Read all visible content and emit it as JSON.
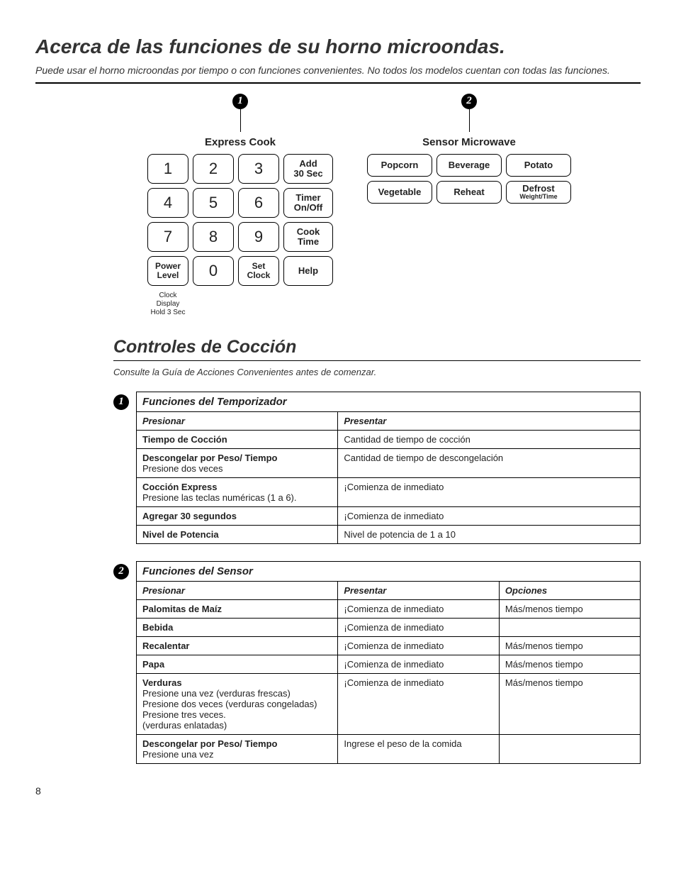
{
  "title": "Acerca de las funciones de su horno microondas.",
  "subtitle": "Puede usar el horno microondas por tiempo o con funciones convenientes. No todos los modelos cuentan con todas las funciones.",
  "panel1": {
    "num": "1",
    "title": "Express Cook",
    "keys": {
      "k1": "1",
      "k2": "2",
      "k3": "3",
      "k4": "4",
      "k5": "5",
      "k6": "6",
      "k7": "7",
      "k8": "8",
      "k9": "9",
      "k0": "0",
      "add30_l1": "Add",
      "add30_l2": "30 Sec",
      "timer_l1": "Timer",
      "timer_l2": "On/Off",
      "cook_l1": "Cook",
      "cook_l2": "Time",
      "power_l1": "Power",
      "power_l2": "Level",
      "setclock_l1": "Set",
      "setclock_l2": "Clock",
      "help": "Help",
      "foot_l1": "Clock Display",
      "foot_l2": "Hold 3 Sec"
    }
  },
  "panel2": {
    "num": "2",
    "title": "Sensor Microwave",
    "keys": {
      "popcorn": "Popcorn",
      "beverage": "Beverage",
      "potato": "Potato",
      "vegetable": "Vegetable",
      "reheat": "Reheat",
      "defrost_l1": "Defrost",
      "defrost_l2": "Weight/Time"
    }
  },
  "section2": {
    "title": "Controles de Cocción",
    "note": "Consulte la Guía de Acciones Convenientes antes de comenzar."
  },
  "table1": {
    "num": "1",
    "title": "Funciones del Temporizador",
    "h1": "Presionar",
    "h2": "Presentar",
    "r1c1": "Tiempo de Cocción",
    "r1c2": "Cantidad de tiempo de cocción",
    "r2c1a": "Descongelar por Peso/ Tiempo",
    "r2c1b": "Presione dos veces",
    "r2c2": "Cantidad de tiempo de descongelación",
    "r3c1a": "Cocción Express",
    "r3c1b": "Presione las teclas numéricas (1 a 6).",
    "r3c2": "¡Comienza de inmediato",
    "r4c1": "Agregar 30 segundos",
    "r4c2": "¡Comienza de inmediato",
    "r5c1": "Nivel de Potencia",
    "r5c2": "Nivel de potencia de 1 a 10"
  },
  "table2": {
    "num": "2",
    "title": "Funciones del Sensor",
    "h1": "Presionar",
    "h2": "Presentar",
    "h3": "Opciones",
    "r1c1": "Palomitas de Maíz",
    "r1c2": "¡Comienza de inmediato",
    "r1c3": "Más/menos tiempo",
    "r2c1": "Bebida",
    "r2c2": "¡Comienza de inmediato",
    "r2c3": "",
    "r3c1": "Recalentar",
    "r3c2": "¡Comienza de inmediato",
    "r3c3": "Más/menos tiempo",
    "r4c1": "Papa",
    "r4c2": "¡Comienza de inmediato",
    "r4c3": "Más/menos tiempo",
    "r5c1a": "Verduras",
    "r5c1b": "Presione una vez (verduras frescas)",
    "r5c1c": "Presione dos veces (verduras congeladas)",
    "r5c1d": "Presione tres veces.",
    "r5c1e": "(verduras enlatadas)",
    "r5c2": "¡Comienza de inmediato",
    "r5c3": "Más/menos tiempo",
    "r6c1a": "Descongelar por Peso/ Tiempo",
    "r6c1b": "Presione una vez",
    "r6c2": "Ingrese el peso de la comida",
    "r6c3": ""
  },
  "page": "8"
}
